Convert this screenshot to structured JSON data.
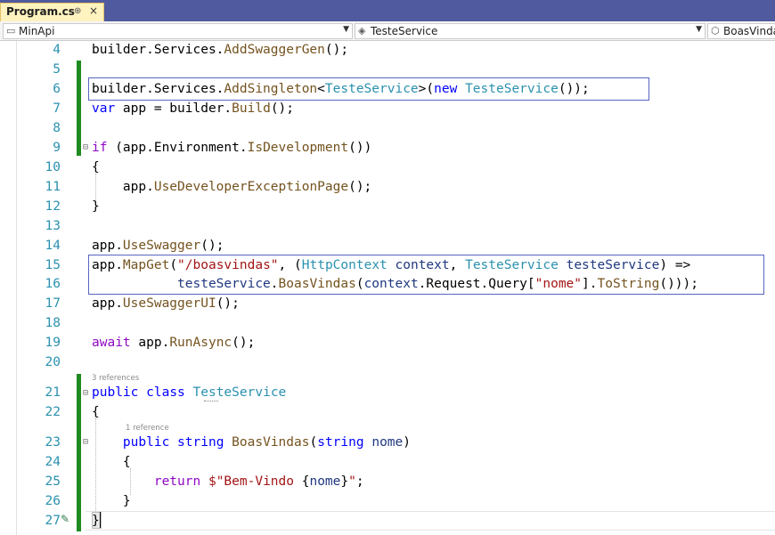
{
  "tab": {
    "title": "Program.cs",
    "pin_glyph": "⊕",
    "close_glyph": "×"
  },
  "nav": {
    "project": "MinApi",
    "class": "TesteService",
    "member": "BoasVindas"
  },
  "colors": {
    "keyword": "#0000ff",
    "control": "#8f08c4",
    "type": "#2b91af",
    "method": "#74531f",
    "string": "#a31515",
    "identifier": "#1f377f",
    "plain": "#000000",
    "linenum": "#2b91af",
    "changebar": "#1f8a1f"
  },
  "lines": [
    {
      "n": "4",
      "tokens": [
        [
          "builder.Services.",
          "p"
        ],
        [
          "AddSwaggerGen",
          "m"
        ],
        [
          "();",
          "p"
        ]
      ]
    },
    {
      "n": "5",
      "tokens": []
    },
    {
      "n": "6",
      "tokens": [
        [
          "builder.Services.",
          "p"
        ],
        [
          "AddSingleton",
          "m"
        ],
        [
          "<",
          "p"
        ],
        [
          "TesteService",
          "t"
        ],
        [
          ">(",
          "p"
        ],
        [
          "new",
          "k"
        ],
        [
          " ",
          "p"
        ],
        [
          "TesteService",
          "t"
        ],
        [
          "());",
          "p"
        ]
      ]
    },
    {
      "n": "7",
      "tokens": [
        [
          "var",
          "k"
        ],
        [
          " app = builder.",
          "p"
        ],
        [
          "Build",
          "m"
        ],
        [
          "();",
          "p"
        ]
      ]
    },
    {
      "n": "8",
      "tokens": []
    },
    {
      "n": "9",
      "tokens": [
        [
          "if",
          "c"
        ],
        [
          " (app.Environment.",
          "p"
        ],
        [
          "IsDevelopment",
          "m"
        ],
        [
          "())",
          "p"
        ]
      ]
    },
    {
      "n": "10",
      "tokens": [
        [
          "{",
          "p"
        ]
      ]
    },
    {
      "n": "11",
      "tokens": [
        [
          "    app.",
          "p"
        ],
        [
          "UseDeveloperExceptionPage",
          "m"
        ],
        [
          "();",
          "p"
        ]
      ]
    },
    {
      "n": "12",
      "tokens": [
        [
          "}",
          "p"
        ]
      ]
    },
    {
      "n": "13",
      "tokens": []
    },
    {
      "n": "14",
      "tokens": [
        [
          "app.",
          "p"
        ],
        [
          "UseSwagger",
          "m"
        ],
        [
          "();",
          "p"
        ]
      ]
    },
    {
      "n": "15",
      "tokens": [
        [
          "app.",
          "p"
        ],
        [
          "MapGet",
          "m"
        ],
        [
          "(",
          "p"
        ],
        [
          "\"/boasvindas\"",
          "s"
        ],
        [
          ", (",
          "p"
        ],
        [
          "HttpContext",
          "t"
        ],
        [
          " ",
          "p"
        ],
        [
          "context",
          "i"
        ],
        [
          ", ",
          "p"
        ],
        [
          "TesteService",
          "t"
        ],
        [
          " ",
          "p"
        ],
        [
          "testeService",
          "i"
        ],
        [
          ") =>",
          "p"
        ]
      ]
    },
    {
      "n": "16",
      "tokens": [
        [
          "           ",
          "p"
        ],
        [
          "testeService",
          "i"
        ],
        [
          ".",
          "p"
        ],
        [
          "BoasVindas",
          "m"
        ],
        [
          "(",
          "p"
        ],
        [
          "context",
          "i"
        ],
        [
          ".Request.Query[",
          "p"
        ],
        [
          "\"nome\"",
          "s"
        ],
        [
          "].",
          "p"
        ],
        [
          "ToString",
          "m"
        ],
        [
          "()));",
          "p"
        ]
      ]
    },
    {
      "n": "17",
      "tokens": [
        [
          "app.",
          "p"
        ],
        [
          "UseSwaggerUI",
          "m"
        ],
        [
          "();",
          "p"
        ]
      ]
    },
    {
      "n": "18",
      "tokens": []
    },
    {
      "n": "19",
      "tokens": [
        [
          "await",
          "c"
        ],
        [
          " app.",
          "p"
        ],
        [
          "RunAsync",
          "m"
        ],
        [
          "();",
          "p"
        ]
      ]
    },
    {
      "n": "20",
      "tokens": []
    },
    {
      "n": "21",
      "tokens": [
        [
          "public",
          "k"
        ],
        [
          " ",
          "p"
        ],
        [
          "class",
          "k"
        ],
        [
          " ",
          "p"
        ],
        [
          "TesteService",
          "t"
        ]
      ]
    },
    {
      "n": "22",
      "tokens": [
        [
          "{",
          "p"
        ]
      ]
    },
    {
      "n": "23",
      "tokens": [
        [
          "    ",
          "p"
        ],
        [
          "public",
          "k"
        ],
        [
          " ",
          "p"
        ],
        [
          "string",
          "k"
        ],
        [
          " ",
          "p"
        ],
        [
          "BoasVindas",
          "m"
        ],
        [
          "(",
          "p"
        ],
        [
          "string",
          "k"
        ],
        [
          " ",
          "p"
        ],
        [
          "nome",
          "i"
        ],
        [
          ")",
          "p"
        ]
      ]
    },
    {
      "n": "24",
      "tokens": [
        [
          "    {",
          "p"
        ]
      ]
    },
    {
      "n": "25",
      "tokens": [
        [
          "        ",
          "p"
        ],
        [
          "return",
          "c"
        ],
        [
          " ",
          "p"
        ],
        [
          "$\"Bem-Vindo ",
          "s"
        ],
        [
          "{",
          "p"
        ],
        [
          "nome",
          "i"
        ],
        [
          "}",
          "p"
        ],
        [
          "\"",
          "s"
        ],
        [
          ";",
          "p"
        ]
      ]
    },
    {
      "n": "26",
      "tokens": [
        [
          "    }",
          "p"
        ]
      ]
    },
    {
      "n": "27",
      "tokens": [
        [
          "}",
          "p"
        ]
      ]
    }
  ],
  "lens": [
    {
      "text": "3 references"
    },
    {
      "text": "1 reference"
    }
  ]
}
